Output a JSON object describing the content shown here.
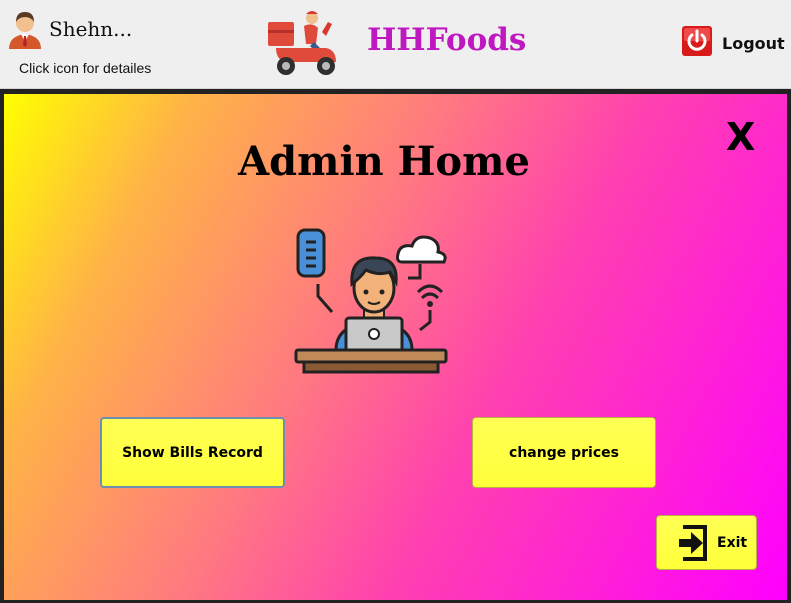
{
  "header": {
    "user_name": "Shehn...",
    "user_hint": "Click icon for detailes",
    "brand": "HHFoods",
    "logout_label": "Logout"
  },
  "panel": {
    "close_label": "X",
    "title": "Admin Home",
    "buttons": {
      "bills": "Show Bills Record",
      "prices": "change prices",
      "exit": "Exit"
    }
  },
  "colors": {
    "brand": "#c018c0",
    "button_yellow": "#ffff3a",
    "gradient_start": "#ffff00",
    "gradient_end": "#ff00ff",
    "logout_red": "#d91a1a"
  },
  "icons": {
    "avatar": "user-avatar-icon",
    "logo": "delivery-scooter-icon",
    "logout": "power-icon",
    "illustration": "admin-laptop-illustration",
    "exit": "exit-door-arrow-icon"
  }
}
